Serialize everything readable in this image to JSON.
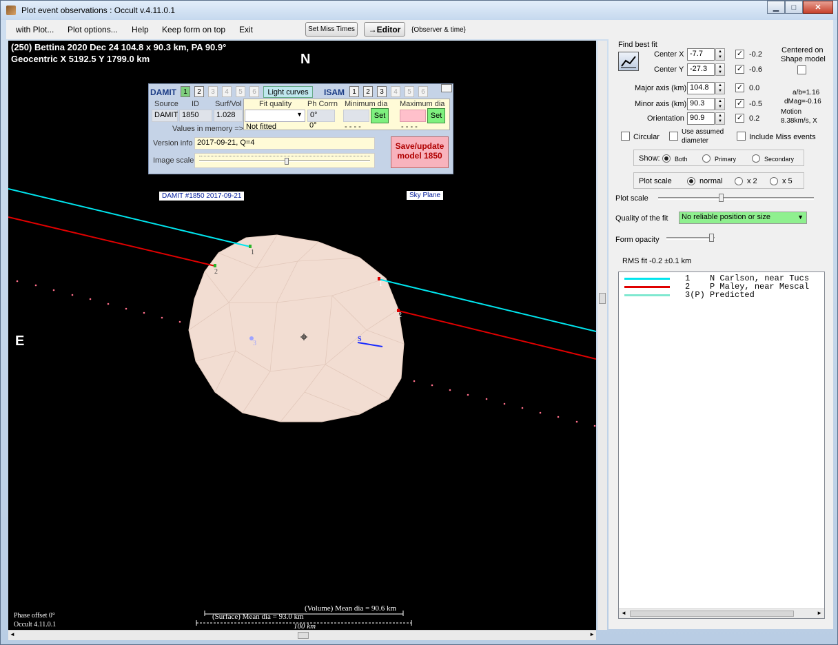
{
  "window": {
    "title": "Plot event observations : Occult v.4.11.0.1",
    "minimize": "▁",
    "maximize": "□",
    "close": "✕"
  },
  "menu": {
    "with_plot": "with Plot...",
    "plot_options": "Plot options...",
    "help": "Help",
    "keep_on_top": "Keep form on top",
    "exit": "Exit"
  },
  "toolbar": {
    "set_miss_times": "Set Miss Times",
    "editor": "→Editor",
    "observer_time": "{Observer & time}"
  },
  "plot": {
    "header1": "(250) Bettina  2020 Dec 24   104.8 x 90.3 km,  PA 90.9°",
    "header2": "Geocentric  X  5192.5  Y  1799.0 km",
    "north": "N",
    "east": "E",
    "damit_label": "DAMIT #1850 2017-09-21",
    "sky_plane": "Sky Plane",
    "phase_offset": "Phase offset 0°",
    "version": "Occult 4.11.0.1",
    "volume_dia": "(Volume) Mean dia = 90.6 km",
    "surface_dia": "(Surface) Mean dia = 93.0 km",
    "scale": "100 km",
    "chord_labels": {
      "c1a": "1",
      "c2a": "2",
      "c1b": "1",
      "c2b": "2",
      "s": "S",
      "p3": "3"
    }
  },
  "damit_panel": {
    "title": "DAMIT",
    "isam": "ISAM",
    "light_curves": "Light curves",
    "damit_nums": [
      "1",
      "2",
      "3",
      "4",
      "5",
      "6"
    ],
    "isam_nums": [
      "1",
      "2",
      "3",
      "4",
      "5",
      "6"
    ],
    "source_hdr": "Source",
    "id_hdr": "ID",
    "surfvol_hdr": "Surf/Vol",
    "source": "DAMIT",
    "id": "1850",
    "surfvol": "1.028",
    "values_in_memory": "Values in memory =>",
    "fit_quality_hdr": "Fit quality",
    "phcorr_hdr": "Ph Corrn",
    "min_dia_hdr": "Minimum dia",
    "max_dia_hdr": "Maximum dia",
    "phcorr": "0°",
    "not_fitted": "Not fitted",
    "phcorr2": "0°",
    "min_dia_mem": "- - - -",
    "max_dia_mem": "- - - -",
    "set": "Set",
    "version_info_lbl": "Version info",
    "version_info": "2017-09-21, Q=4",
    "image_scale_lbl": "Image scale",
    "save_line1": "Save/update",
    "save_line2": "model  1850"
  },
  "fit_panel": {
    "find_best_fit": "Find best fit",
    "center_x_lbl": "Center X",
    "center_x": "-7.7",
    "center_x_d": "-0.2",
    "center_y_lbl": "Center Y",
    "center_y": "-27.3",
    "center_y_d": "-0.6",
    "major_lbl": "Major axis (km)",
    "major": "104.8",
    "major_d": "0.0",
    "minor_lbl": "Minor axis (km)",
    "minor": "90.3",
    "minor_d": "-0.5",
    "orient_lbl": "Orientation",
    "orient": "90.9",
    "orient_d": "0.2",
    "centered_on": "Centered on",
    "shape_model": "Shape model",
    "ab_ratio": "a/b=1.16",
    "dmag": "dMag=-0.16",
    "motion": "Motion",
    "motion_val": "8.38km/s, X",
    "circular": "Circular",
    "use_assumed": "Use assumed",
    "diameter": "diameter",
    "include_miss": "Include Miss events",
    "show_lbl": "Show:",
    "both": "Both",
    "primary": "Primary",
    "secondary": "Secondary",
    "plot_scale_grp": "Plot scale",
    "normal": "normal",
    "x2": "x 2",
    "x5": "x 5",
    "plot_scale_lbl": "Plot scale",
    "quality_lbl": "Quality of the fit",
    "quality_val": "No reliable position or size",
    "form_opacity": "Form opacity",
    "rms": "RMS fit -0.2 ±0.1 km"
  },
  "legend": [
    {
      "text": "1    N Carlson, near Tucs",
      "color": "#00e5ee"
    },
    {
      "text": "2    P Maley, near Mescal",
      "color": "#e00000"
    },
    {
      "text": "3(P) Predicted",
      "color": "#7fe8d0"
    }
  ],
  "colors": {
    "chord1": "#00e5ee",
    "chord2": "#e00000",
    "body": "#f2ddd2",
    "quality": "#8ff08f"
  }
}
